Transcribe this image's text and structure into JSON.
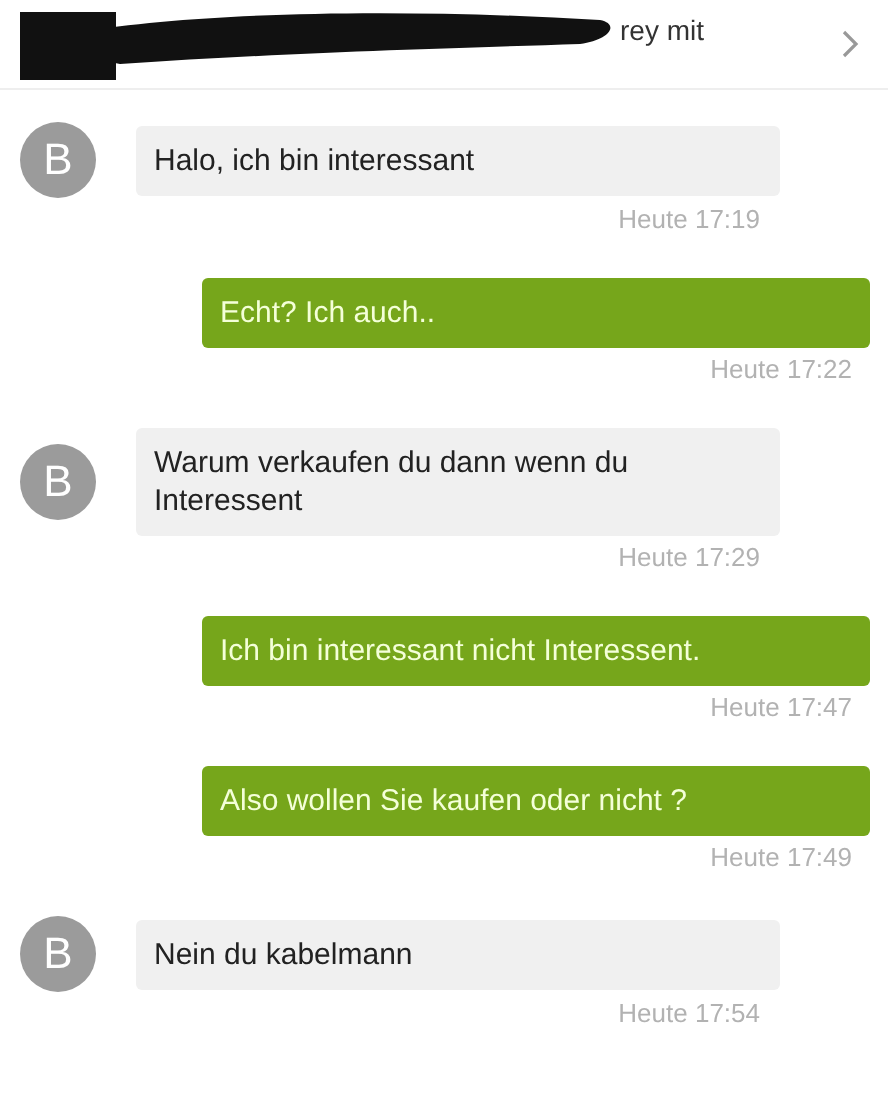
{
  "header": {
    "title": "rey mit"
  },
  "messages": [
    {
      "kind": "incoming",
      "avatar": "B",
      "text": "Halo, ich bin interessant",
      "time": "Heute 17:19"
    },
    {
      "kind": "outgoing",
      "text": "Echt? Ich auch..",
      "time": "Heute 17:22"
    },
    {
      "kind": "incoming",
      "avatar": "B",
      "text": "Warum verkaufen du dann wenn du Interessent",
      "time": "Heute 17:29"
    },
    {
      "kind": "outgoing",
      "text": "Ich bin interessant nicht Interessent.",
      "time": "Heute 17:47"
    },
    {
      "kind": "outgoing",
      "text": "Also wollen Sie kaufen oder nicht ?",
      "time": "Heute 17:49"
    },
    {
      "kind": "incoming",
      "avatar": "B",
      "text": "Nein du kabelmann",
      "time": "Heute 17:54"
    }
  ]
}
